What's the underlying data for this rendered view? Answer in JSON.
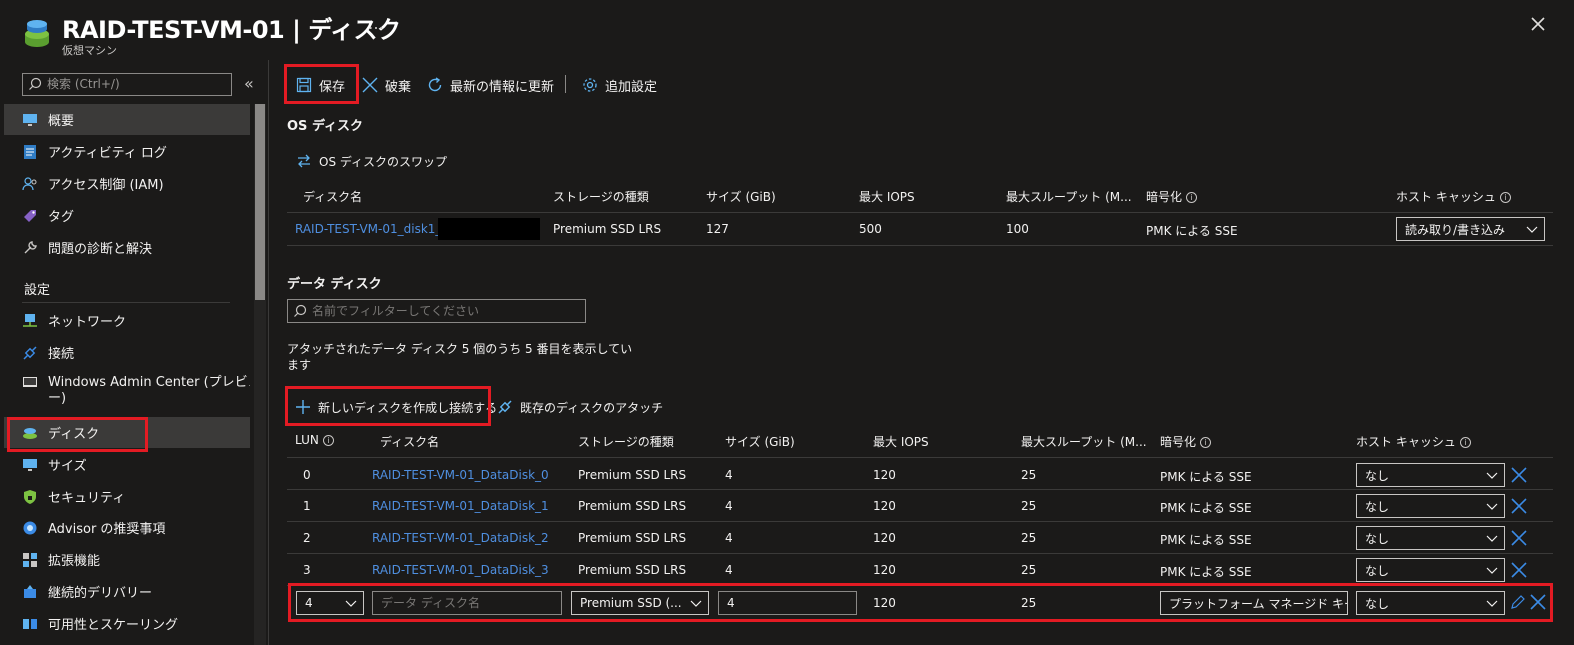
{
  "header": {
    "title": "RAID-TEST-VM-01 | ディスク",
    "subtitle": "仮想マシン",
    "more": "…",
    "close": "✕"
  },
  "sidebar": {
    "search_placeholder": "検索 (Ctrl+/)",
    "collapse": "«",
    "items_top": [
      {
        "label": "概要",
        "icon": "monitor-icon"
      },
      {
        "label": "アクティビティ ログ",
        "icon": "log-icon"
      },
      {
        "label": "アクセス制御 (IAM)",
        "icon": "people-icon"
      },
      {
        "label": "タグ",
        "icon": "tag-icon"
      },
      {
        "label": "問題の診断と解決",
        "icon": "wrench-icon"
      }
    ],
    "section_settings": "設定",
    "items_settings": [
      {
        "label": "ネットワーク",
        "icon": "network-icon"
      },
      {
        "label": "接続",
        "icon": "plug-icon"
      },
      {
        "label": "Windows Admin Center (プレビュ",
        "label2": "ー)",
        "icon": "admin-center-icon"
      },
      {
        "label": "ディスク",
        "icon": "disk-icon",
        "selected": true
      },
      {
        "label": "サイズ",
        "icon": "size-icon"
      },
      {
        "label": "セキュリティ",
        "icon": "shield-icon"
      },
      {
        "label": "Advisor の推奨事項",
        "icon": "advisor-icon"
      },
      {
        "label": "拡張機能",
        "icon": "extensions-icon"
      },
      {
        "label": "継続的デリバリー",
        "icon": "delivery-icon"
      },
      {
        "label": "可用性とスケーリング",
        "icon": "scaling-icon"
      }
    ]
  },
  "toolbar": {
    "save": "保存",
    "discard": "破棄",
    "refresh": "最新の情報に更新",
    "additional_settings": "追加設定"
  },
  "os_disk": {
    "title": "OS ディスク",
    "swap": "OS ディスクのスワップ",
    "columns": [
      "ディスク名",
      "ストレージの種類",
      "サイズ (GiB)",
      "最大 IOPS",
      "最大スループット (M...",
      "暗号化",
      "ホスト キャッシュ"
    ],
    "row": {
      "name": "RAID-TEST-VM-01_disk1_",
      "storage": "Premium SSD LRS",
      "size": "127",
      "iops": "500",
      "throughput": "100",
      "encryption": "PMK による SSE",
      "cache": "読み取り/書き込み"
    }
  },
  "data_disks": {
    "title": "データ ディスク",
    "filter_placeholder": "名前でフィルターしてください",
    "count_text_1": "アタッチされたデータ ディスク 5 個のうち 5 番目を表示してい",
    "count_text_2": "ます",
    "create_attach": "新しいディスクを作成し接続する",
    "attach_existing": "既存のディスクのアタッチ",
    "columns": [
      "LUN",
      "ディスク名",
      "ストレージの種類",
      "サイズ (GiB)",
      "最大 IOPS",
      "最大スループット (M...",
      "暗号化",
      "ホスト キャッシュ"
    ],
    "rows": [
      {
        "lun": "0",
        "name": "RAID-TEST-VM-01_DataDisk_0",
        "storage": "Premium SSD LRS",
        "size": "4",
        "iops": "120",
        "throughput": "25",
        "encryption": "PMK による SSE",
        "cache": "なし"
      },
      {
        "lun": "1",
        "name": "RAID-TEST-VM-01_DataDisk_1",
        "storage": "Premium SSD LRS",
        "size": "4",
        "iops": "120",
        "throughput": "25",
        "encryption": "PMK による SSE",
        "cache": "なし"
      },
      {
        "lun": "2",
        "name": "RAID-TEST-VM-01_DataDisk_2",
        "storage": "Premium SSD LRS",
        "size": "4",
        "iops": "120",
        "throughput": "25",
        "encryption": "PMK による SSE",
        "cache": "なし"
      },
      {
        "lun": "3",
        "name": "RAID-TEST-VM-01_DataDisk_3",
        "storage": "Premium SSD LRS",
        "size": "4",
        "iops": "120",
        "throughput": "25",
        "encryption": "PMK による SSE",
        "cache": "なし"
      }
    ],
    "new_row": {
      "lun": "4",
      "name_placeholder": "データ ディスク名",
      "storage": "Premium SSD (...",
      "size": "4",
      "iops": "120",
      "throughput": "25",
      "encryption": "プラットフォーム マネージド キー",
      "cache": "なし"
    }
  },
  "colors": {
    "background": "#1b1a19",
    "link": "#4f8fe0",
    "highlight": "#e31b23",
    "accent": "#3b8be6"
  }
}
